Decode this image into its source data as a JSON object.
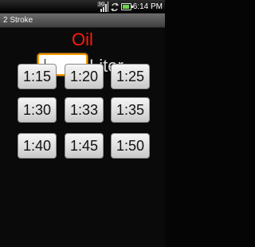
{
  "status_bar": {
    "time": "6:14 PM",
    "network_tag": "3G",
    "icons": [
      "signal-icon",
      "sync-icon",
      "battery-icon"
    ]
  },
  "app": {
    "title": "2 Stroke"
  },
  "main": {
    "heading": "Oil",
    "heading_color": "#ff1a0a",
    "liter_input": {
      "value": "",
      "placeholder": ""
    },
    "unit_label": "Liter",
    "ratio_buttons": [
      "1:15",
      "1:20",
      "1:25",
      "1:30",
      "1:33",
      "1:35",
      "1:40",
      "1:45",
      "1:50"
    ]
  }
}
